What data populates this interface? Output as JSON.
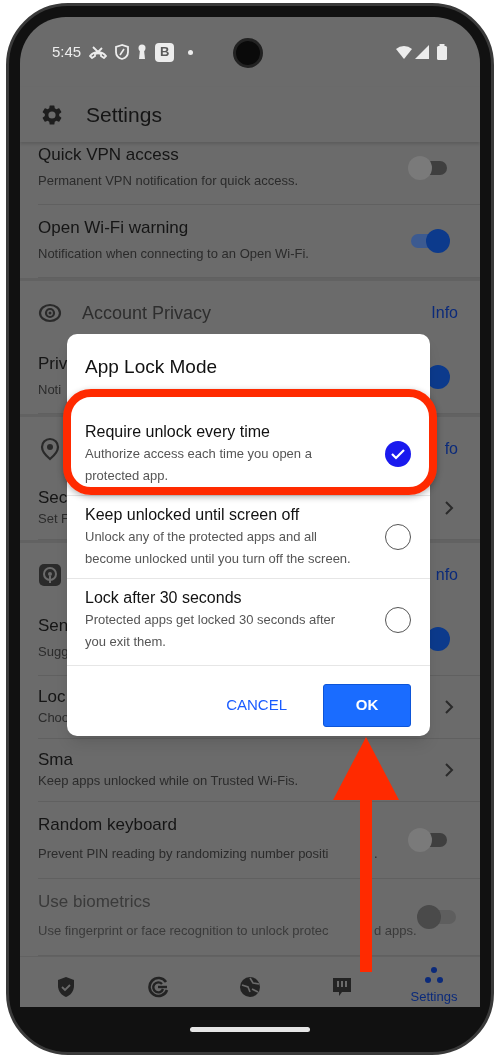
{
  "status_bar": {
    "time": "5:45",
    "app_badge": "B"
  },
  "header": {
    "title": "Settings"
  },
  "rows": [
    {
      "kind": "toggle",
      "title": "Quick VPN access",
      "subtitle": "Permanent VPN notification for quick access.",
      "on": false,
      "disabled": false
    },
    {
      "kind": "toggle",
      "title": "Open Wi-Fi warning",
      "subtitle": "Notification when connecting to an Open Wi-Fi.",
      "on": true,
      "disabled": false
    },
    {
      "kind": "section",
      "title": "Account Privacy",
      "action": "Info"
    },
    {
      "kind": "toggle",
      "title": "Priv",
      "subtitle": "Noti",
      "on": true,
      "disabled": false
    },
    {
      "kind": "section",
      "action": "fo"
    },
    {
      "kind": "link",
      "title": "Sec",
      "subtitle": "Set F"
    },
    {
      "kind": "section",
      "action": "nfo"
    },
    {
      "kind": "toggle",
      "title": "Sen",
      "subtitle": "Sugg",
      "on": true,
      "disabled": false
    },
    {
      "kind": "link",
      "title": "Loc",
      "subtitle": "Choo"
    },
    {
      "kind": "link",
      "title": "Sma",
      "subtitle": "Keep apps unlocked while on Trusted Wi-Fis."
    },
    {
      "kind": "toggle",
      "title": "Random keyboard",
      "subtitle_segments": [
        "Prevent PIN reading by randomizing number positi",
        "."
      ],
      "on": false,
      "disabled": false
    },
    {
      "kind": "toggle",
      "title": "Use biometrics",
      "subtitle_segments": [
        "Use fingerprint or face recognition to unlock protec",
        "d apps."
      ],
      "on": false,
      "disabled": true
    }
  ],
  "dialog": {
    "title": "App Lock Mode",
    "options": [
      {
        "title": "Require unlock every time",
        "description": "Authorize access each time you open a protected app.",
        "selected": true
      },
      {
        "title": "Keep unlocked until screen off",
        "description": "Unlock any of the protected apps and all become unlocked until you turn off the screen.",
        "selected": false
      },
      {
        "title": "Lock after 30 seconds",
        "description": "Protected apps get locked 30 seconds after you exit them.",
        "selected": false
      }
    ],
    "buttons": [
      {
        "label": "CANCEL",
        "kind": "text"
      },
      {
        "label": "OK",
        "kind": "filled"
      }
    ]
  },
  "nav": [
    {
      "selected": false
    },
    {
      "selected": false
    },
    {
      "selected": false
    },
    {
      "selected": false
    },
    {
      "label": "Settings",
      "selected": true
    }
  ]
}
